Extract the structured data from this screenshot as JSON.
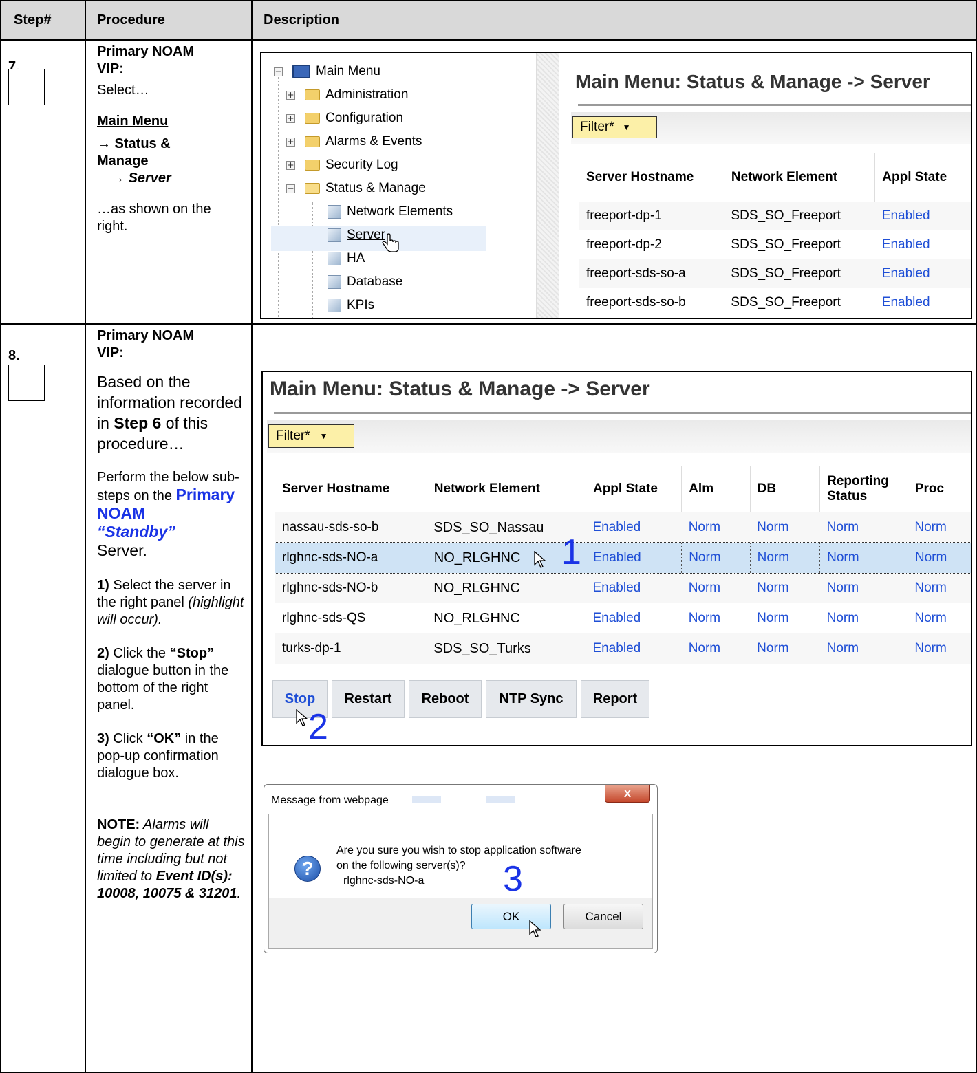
{
  "header": {
    "step": "Step#",
    "procedure": "Procedure",
    "description": "Description"
  },
  "step7": {
    "number": "7.",
    "role": "Primary NOAM VIP:",
    "select": "Select…",
    "menu": "Main Menu",
    "path1": "→ Status & Manage",
    "path2": "→ Server",
    "tail": "…as shown on the right.",
    "tree": {
      "root": "Main Menu",
      "items": [
        "Administration",
        "Configuration",
        "Alarms & Events",
        "Security Log",
        "Status & Manage"
      ],
      "subitems": [
        "Network Elements",
        "Server",
        "HA",
        "Database",
        "KPIs"
      ]
    },
    "panel": {
      "title": "Main Menu: Status & Manage -> Server",
      "filter": "Filter*",
      "columns": [
        "Server Hostname",
        "Network Element",
        "Appl State"
      ],
      "rows": [
        [
          "freeport-dp-1",
          "SDS_SO_Freeport",
          "Enabled"
        ],
        [
          "freeport-dp-2",
          "SDS_SO_Freeport",
          "Enabled"
        ],
        [
          "freeport-sds-so-a",
          "SDS_SO_Freeport",
          "Enabled"
        ],
        [
          "freeport-sds-so-b",
          "SDS_SO_Freeport",
          "Enabled"
        ]
      ]
    }
  },
  "step8": {
    "number": "8.",
    "role": "Primary NOAM VIP:",
    "p1a": "Based on the information recorded in ",
    "p1b": "Step 6",
    "p1c": " of this procedure…",
    "p2a": "Perform the below sub-steps on the ",
    "p2b": "Primary NOAM",
    "p2c": "“Standby”",
    "p2d": "Server.",
    "s1a": "1)",
    "s1b": " Select the server in the right panel ",
    "s1c": "(highlight will occur).",
    "s2a": "2)",
    "s2b": " Click the ",
    "s2c": "“Stop”",
    "s2d": " dialogue button in the bottom of the right panel.",
    "s3a": "3)",
    "s3b": " Click ",
    "s3c": "“OK”",
    "s3d": " in the pop-up confirmation dialogue box.",
    "noteA": "NOTE:",
    "noteB": "  Alarms will begin to generate at this time including but not limited to ",
    "noteC": "Event ID(s): 10008, 10075 & 31201",
    "noteD": ".",
    "panel": {
      "title": "Main Menu: Status & Manage -> Server",
      "filter": "Filter*",
      "columns": [
        "Server Hostname",
        "Network Element",
        "Appl State",
        "Alm",
        "DB",
        "Reporting Status",
        "Proc"
      ],
      "rows": [
        [
          "nassau-sds-so-b",
          "SDS_SO_Nassau",
          "Enabled",
          "Norm",
          "Norm",
          "Norm",
          "Norm"
        ],
        [
          "rlghnc-sds-NO-a",
          "NO_RLGHNC",
          "Enabled",
          "Norm",
          "Norm",
          "Norm",
          "Norm"
        ],
        [
          "rlghnc-sds-NO-b",
          "NO_RLGHNC",
          "Enabled",
          "Norm",
          "Norm",
          "Norm",
          "Norm"
        ],
        [
          "rlghnc-sds-QS",
          "NO_RLGHNC",
          "Enabled",
          "Norm",
          "Norm",
          "Norm",
          "Norm"
        ],
        [
          "turks-dp-1",
          "SDS_SO_Turks",
          "Enabled",
          "Norm",
          "Norm",
          "Norm",
          "Norm"
        ]
      ],
      "buttons": [
        "Stop",
        "Restart",
        "Reboot",
        "NTP Sync",
        "Report"
      ],
      "annotations": [
        "1",
        "2",
        "3"
      ]
    },
    "dialog": {
      "title": "Message from webpage",
      "message1": "Are you sure you wish to stop application software",
      "message2": "on the following server(s)?",
      "server": "rlghnc-sds-NO-a",
      "ok": "OK",
      "cancel": "Cancel",
      "close": "X"
    }
  }
}
